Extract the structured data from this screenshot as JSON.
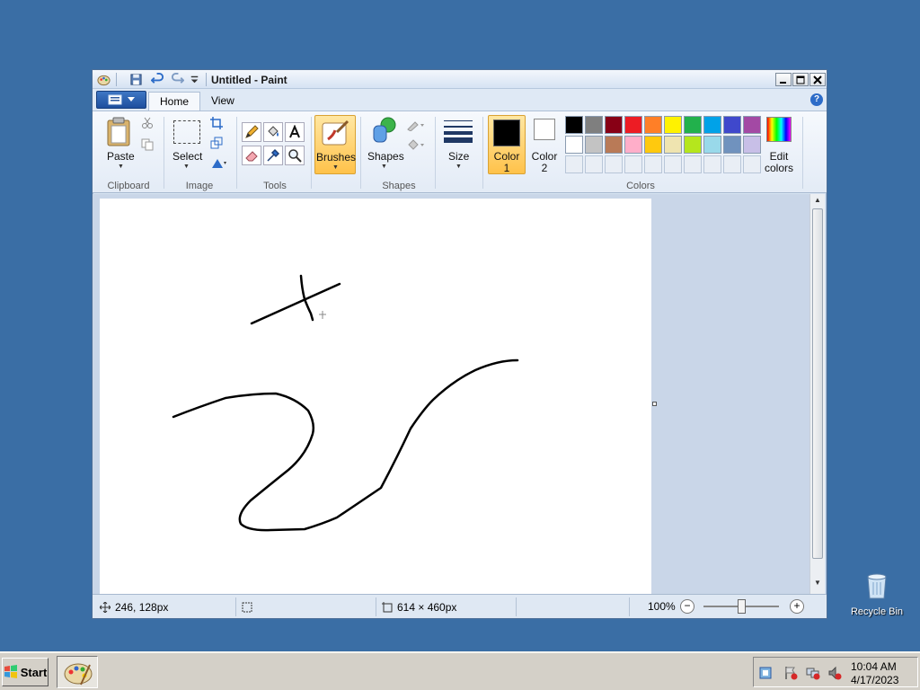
{
  "window": {
    "title": "Untitled - Paint",
    "tabs": {
      "home": "Home",
      "view": "View"
    },
    "help_glyph": "?"
  },
  "ribbon": {
    "clipboard": {
      "paste_label": "Paste",
      "group_label": "Clipboard"
    },
    "image": {
      "select_label": "Select",
      "group_label": "Image"
    },
    "tools": {
      "group_label": "Tools"
    },
    "brushes": {
      "label": "Brushes"
    },
    "shapes": {
      "label": "Shapes",
      "group_label": "Shapes"
    },
    "size": {
      "label": "Size"
    },
    "colors": {
      "color1_label": "Color",
      "color1_num": "1",
      "color2_label": "Color",
      "color2_num": "2",
      "edit_label_1": "Edit",
      "edit_label_2": "colors",
      "group_label": "Colors",
      "color1_value": "#000000",
      "color2_value": "#ffffff",
      "palette": [
        "#000000",
        "#7f7f7f",
        "#880015",
        "#ed1c24",
        "#ff7f27",
        "#fff200",
        "#22b14c",
        "#00a2e8",
        "#3f48cc",
        "#a349a4",
        "#ffffff",
        "#c3c3c3",
        "#b97a57",
        "#ffaec9",
        "#ffc90e",
        "#efe4b0",
        "#b5e61d",
        "#99d9ea",
        "#7092be",
        "#c8bfe7",
        "",
        "",
        "",
        "",
        "",
        "",
        "",
        "",
        "",
        ""
      ]
    }
  },
  "status": {
    "cursor_pos": "246, 128px",
    "image_size": "614 × 460px",
    "zoom": "100%"
  },
  "desktop": {
    "recycle_bin": "Recycle Bin"
  },
  "taskbar": {
    "start": "Start",
    "time": "10:04 AM",
    "date": "4/17/2023"
  }
}
